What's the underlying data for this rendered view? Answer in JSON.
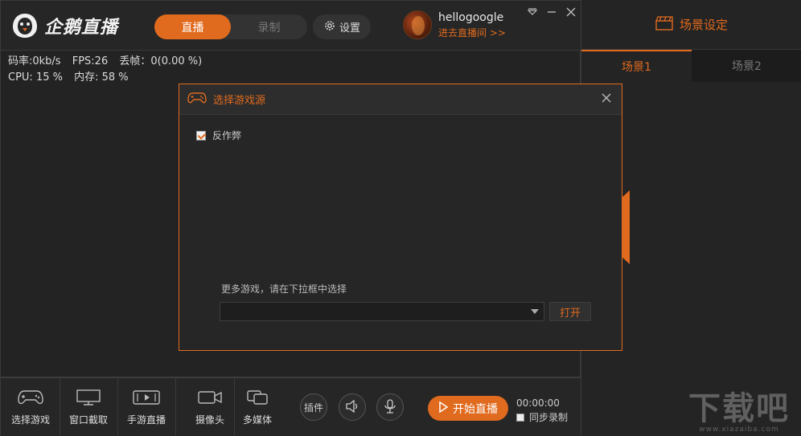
{
  "app": {
    "logo_text": "企鹅直播",
    "tabs": {
      "live": "直播",
      "record": "录制"
    },
    "settings_label": "设置",
    "user": {
      "name": "hellogoogle",
      "go_room": "进去直播间 >>"
    },
    "window_controls": [
      "menu-icon",
      "minimize-icon",
      "close-icon"
    ]
  },
  "stats": {
    "bitrate": "码率:0kb/s",
    "fps": "FPS:26",
    "dropped": "丢帧：0(0.00 %)",
    "cpu": "CPU: 15 %",
    "memory": "内存: 58 %"
  },
  "toolbar": {
    "tools": [
      {
        "label": "选择游戏",
        "icon": "gamepad-icon"
      },
      {
        "label": "窗口截取",
        "icon": "monitor-icon"
      },
      {
        "label": "手游直播",
        "icon": "mobile-play-icon"
      },
      {
        "label": "摄像头",
        "icon": "camera-icon"
      },
      {
        "label": "多媒体",
        "icon": "media-icon"
      }
    ],
    "plugin_label": "插件",
    "start_label": "开始直播",
    "timer": "00:00:00",
    "sync_label": "同步录制"
  },
  "scene_panel": {
    "title": "场景设定",
    "tabs": [
      "场景1",
      "场景2"
    ]
  },
  "modal": {
    "title": "选择游戏源",
    "anticheat_label": "反作弊",
    "anticheat_checked": true,
    "more_games_label": "更多游戏，请在下拉框中选择",
    "select_value": "",
    "open_label": "打开"
  },
  "watermark": {
    "logo": "下载吧",
    "sub": "www.xiazaiba.com"
  },
  "colors": {
    "accent": "#e06a1e",
    "bg": "#232323"
  }
}
